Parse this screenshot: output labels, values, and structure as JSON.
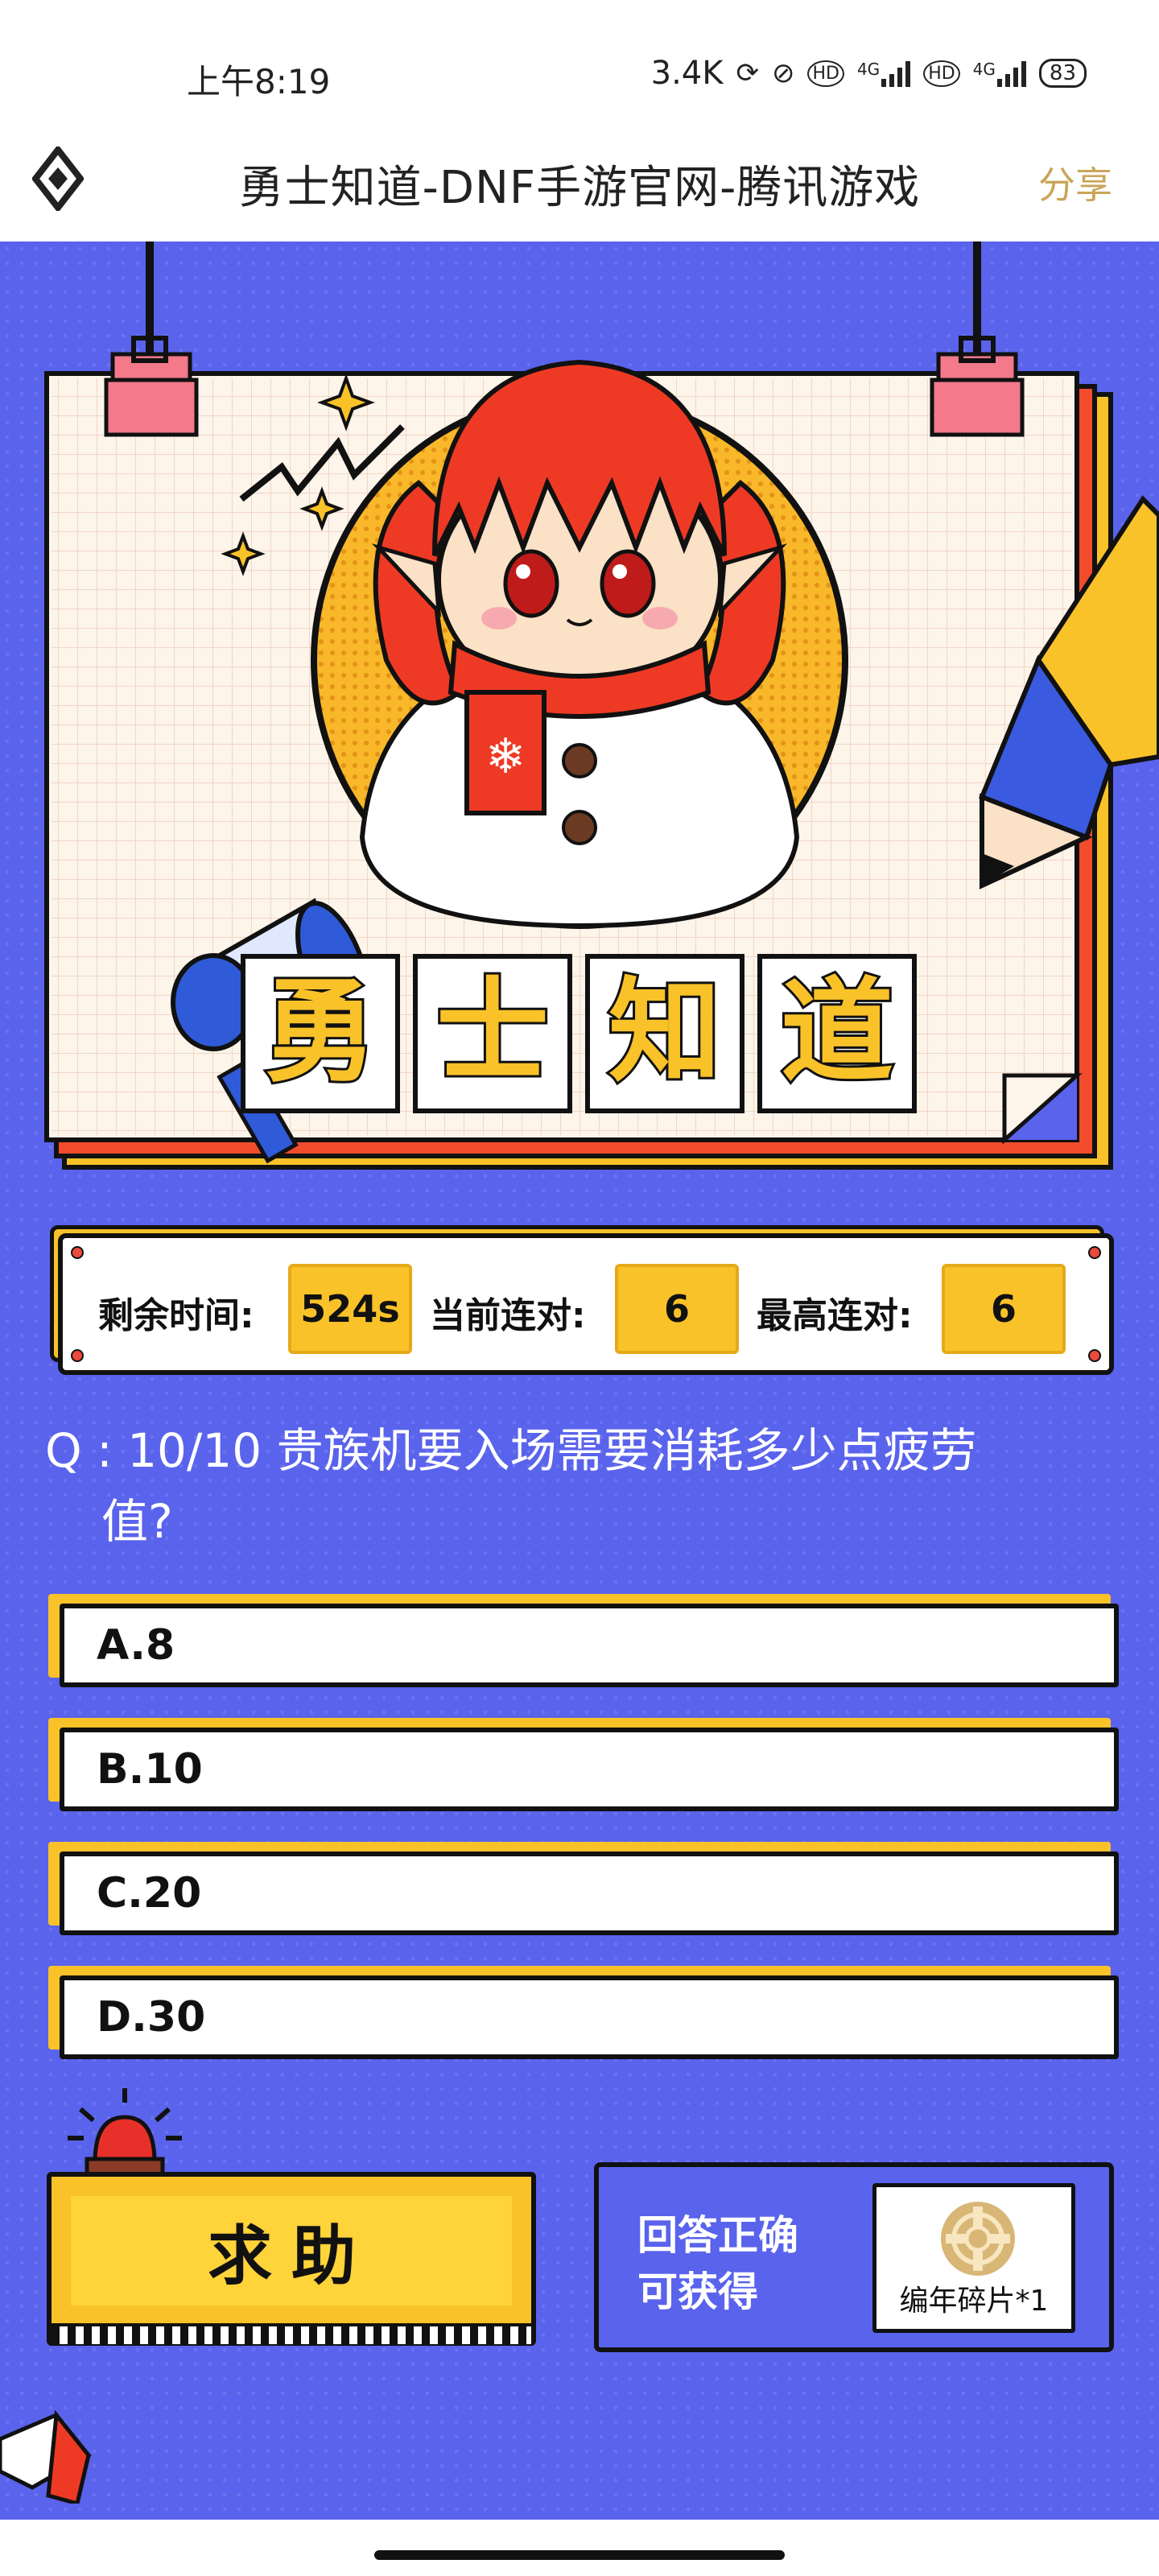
{
  "status_bar": {
    "time": "上午8:19",
    "network_speed": "3.4K",
    "signal_1_label": "4G",
    "signal_2_label": "4G",
    "battery": "83"
  },
  "nav": {
    "title": "勇士知道-DNF手游官网-腾讯游戏",
    "share": "分享"
  },
  "hero": {
    "title_chars": [
      "勇",
      "士",
      "知",
      "道"
    ]
  },
  "stats": {
    "time_label": "剩余时间:",
    "time_value": "524s",
    "streak_label": "当前连对:",
    "streak_value": "6",
    "best_label": "最高连对:",
    "best_value": "6"
  },
  "question": {
    "line1": "Q : 10/10 贵族机要入场需要消耗多少点疲劳",
    "line2": "值?"
  },
  "options": [
    {
      "label": "A.8"
    },
    {
      "label": "B.10"
    },
    {
      "label": "C.20"
    },
    {
      "label": "D.30"
    }
  ],
  "help": {
    "label": "求助"
  },
  "reward": {
    "line1": "回答正确",
    "line2": "可获得",
    "item": "编年碎片*1"
  },
  "colors": {
    "background": "#5a63ec",
    "accent_yellow": "#f9c229",
    "share_gold": "#c9a559",
    "red": "#e94b3c"
  }
}
